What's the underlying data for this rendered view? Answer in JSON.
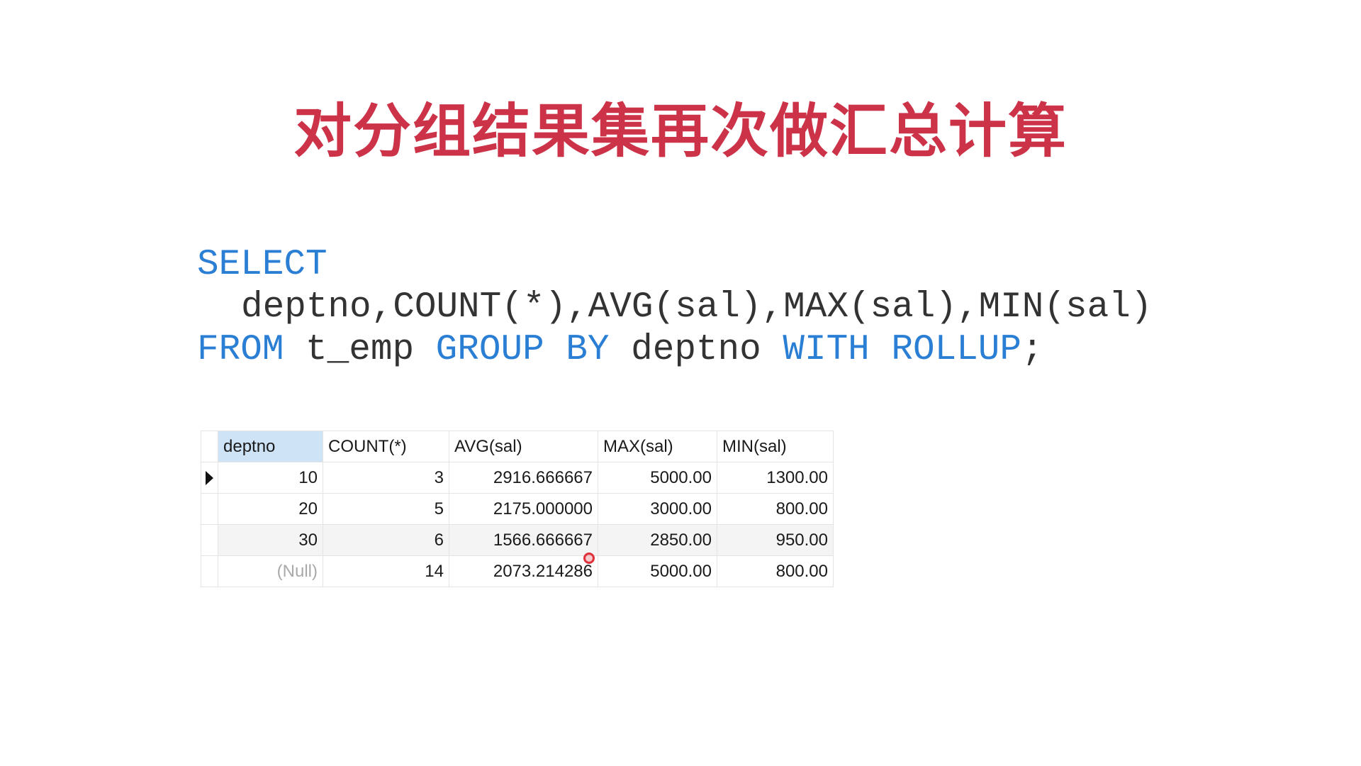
{
  "slide": {
    "title": "对分组结果集再次做汇总计算"
  },
  "sql": {
    "select_kw": "SELECT",
    "columns": "deptno,COUNT(*),AVG(sal),MAX(sal),MIN(sal)",
    "from_kw": "FROM",
    "table": " t_emp ",
    "group_by_kw": "GROUP BY",
    "group_col": " deptno ",
    "with_rollup_kw": "WITH ROLLUP",
    "terminator": ";"
  },
  "result": {
    "headers": [
      "deptno",
      "COUNT(*)",
      "AVG(sal)",
      "MAX(sal)",
      "MIN(sal)"
    ],
    "rows": [
      [
        "10",
        "3",
        "2916.666667",
        "5000.00",
        "1300.00"
      ],
      [
        "20",
        "5",
        "2175.000000",
        "3000.00",
        "800.00"
      ],
      [
        "30",
        "6",
        "1566.666667",
        "2850.00",
        "950.00"
      ],
      [
        "(Null)",
        "14",
        "2073.214286",
        "5000.00",
        "800.00"
      ]
    ]
  },
  "colors": {
    "title": "#cc3348",
    "keyword": "#2a7fd4",
    "code": "#333333"
  }
}
